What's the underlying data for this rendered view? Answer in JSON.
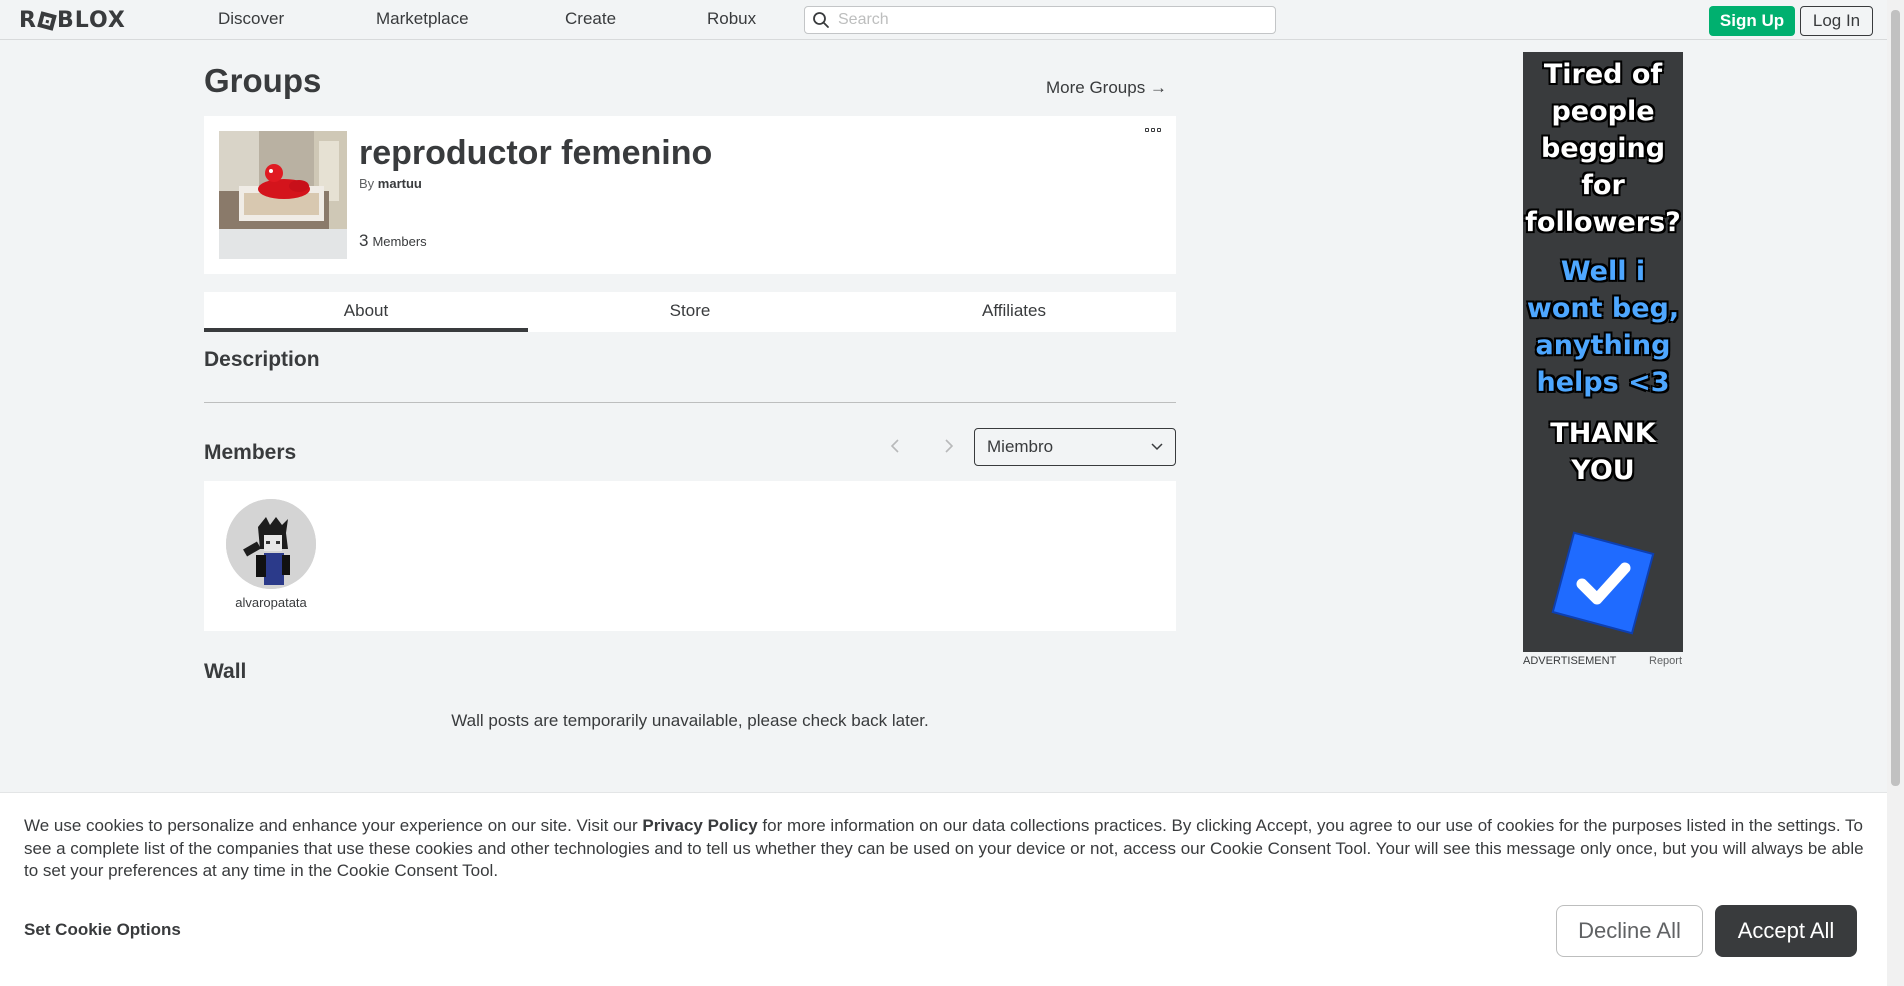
{
  "nav": {
    "logo": "ROBLOX",
    "links": [
      "Discover",
      "Marketplace",
      "Create",
      "Robux"
    ],
    "search_placeholder": "Search",
    "signup": "Sign Up",
    "login": "Log In"
  },
  "page": {
    "title": "Groups",
    "more_groups": "More Groups →"
  },
  "group": {
    "name": "reproductor femenino",
    "by_prefix": "By",
    "owner": "martuu",
    "member_count": "3",
    "member_label": "Members"
  },
  "tabs": [
    {
      "label": "About",
      "active": true
    },
    {
      "label": "Store",
      "active": false
    },
    {
      "label": "Affiliates",
      "active": false
    }
  ],
  "sections": {
    "description": "Description",
    "members": "Members",
    "wall": "Wall"
  },
  "members": {
    "rank_selected": "Miembro",
    "list": [
      {
        "username": "alvaropatata"
      }
    ]
  },
  "wall": {
    "message": "Wall posts are temporarily unavailable, please check back later."
  },
  "ad": {
    "lines_white": [
      "Tired of",
      "people",
      "begging",
      "for",
      "followers?"
    ],
    "lines_blue": [
      "Well i",
      "wont beg,",
      "anything",
      "helps <3"
    ],
    "lines_thanks": [
      "THANK",
      "YOU"
    ],
    "label": "ADVERTISEMENT",
    "report": "Report"
  },
  "cookie": {
    "text_before": "We use cookies to personalize and enhance your experience on our site. Visit our ",
    "link": "Privacy Policy",
    "text_after": " for more information on our data collections practices. By clicking Accept, you agree to our use of cookies for the purposes listed in the settings. To see a complete list of the companies that use these cookies and other technologies and to tell us whether they can be used on your device or not, access our Cookie Consent Tool. Your will see this message only once, but you will always be able to set your preferences at any time in the Cookie Consent Tool.",
    "options": "Set Cookie Options",
    "decline": "Decline All",
    "accept": "Accept All"
  },
  "colors": {
    "signup_green": "#00b06f",
    "page_bg": "#f2f4f5",
    "text_dark": "#393b3d",
    "ad_blue_check": "#1f6bff"
  }
}
